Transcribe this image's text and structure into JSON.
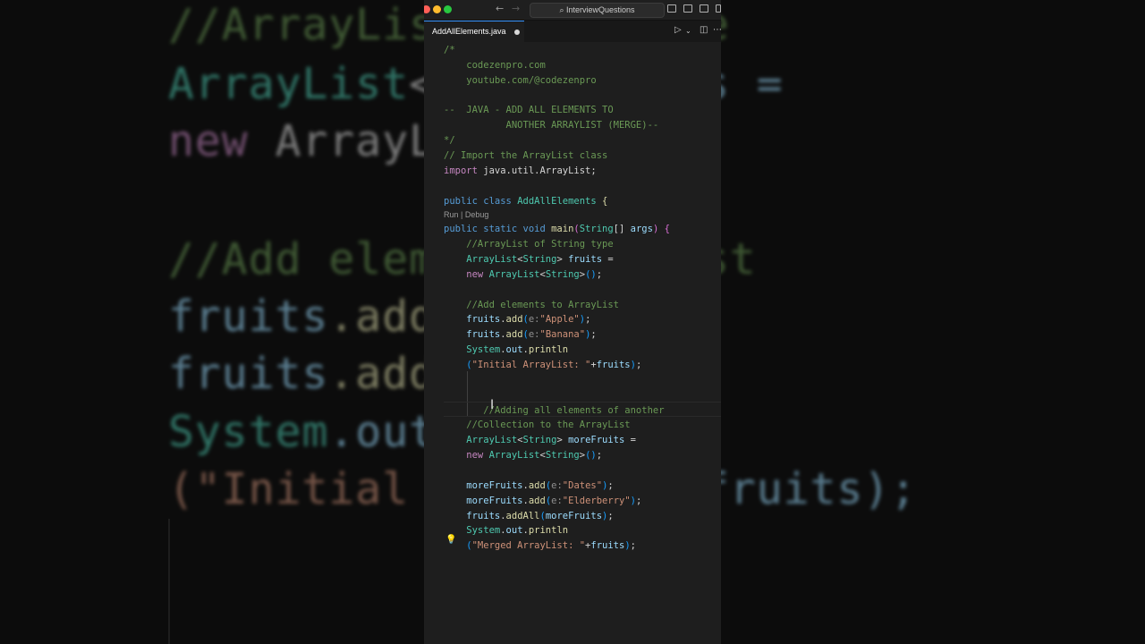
{
  "background": {
    "lines": [
      {
        "parts": [
          {
            "t": "//ArrayList",
            "c": "c-comment"
          },
          {
            "t": "       ",
            "c": "c-txt"
          },
          {
            "t": "ype",
            "c": "c-comment"
          }
        ]
      },
      {
        "parts": [
          {
            "t": "ArrayList",
            "c": "c-type"
          },
          {
            "t": "<S",
            "c": "c-txt"
          },
          {
            "t": "         ",
            "c": "c-txt"
          },
          {
            "t": "s =",
            "c": "c-var"
          }
        ]
      },
      {
        "parts": [
          {
            "t": "new ",
            "c": "c-kw"
          },
          {
            "t": "ArrayLi",
            "c": "c-txt"
          }
        ]
      },
      {
        "parts": [
          {
            "t": "//Add eleme",
            "c": "c-comment"
          },
          {
            "t": "       ",
            "c": "c-txt"
          },
          {
            "t": "List",
            "c": "c-comment"
          }
        ]
      },
      {
        "parts": [
          {
            "t": "fruits",
            "c": "c-var"
          },
          {
            "t": ".add(",
            "c": "c-fn"
          }
        ]
      },
      {
        "parts": [
          {
            "t": "fruits",
            "c": "c-var"
          },
          {
            "t": ".add(",
            "c": "c-fn"
          }
        ]
      },
      {
        "parts": [
          {
            "t": "System",
            "c": "c-type"
          },
          {
            "t": ".out.",
            "c": "c-var"
          }
        ]
      },
      {
        "parts": [
          {
            "t": "(\"Initial A",
            "c": "c-str"
          },
          {
            "t": "         ",
            "c": "c-txt"
          },
          {
            "t": "fruits);",
            "c": "c-var"
          }
        ]
      }
    ]
  },
  "titlebar": {
    "search_label": "InterviewQuestions",
    "colors": {
      "close": "#ff5f57",
      "minimize": "#febc2e",
      "maximize": "#28c840"
    }
  },
  "tab": {
    "label": "AddAllElements.java",
    "modified": true
  },
  "codelens": "Run | Debug",
  "code": [
    {
      "parts": [
        {
          "t": "/*",
          "c": "c-comment"
        }
      ]
    },
    {
      "parts": [
        {
          "t": "    codezenpro.com",
          "c": "c-comment"
        }
      ]
    },
    {
      "parts": [
        {
          "t": "    youtube.com/@codezenpro",
          "c": "c-comment"
        }
      ]
    },
    {
      "parts": [
        {
          "t": "",
          "c": "c-comment"
        }
      ]
    },
    {
      "parts": [
        {
          "t": "--  JAVA - ADD ALL ELEMENTS TO",
          "c": "c-comment"
        }
      ]
    },
    {
      "parts": [
        {
          "t": "           ANOTHER ARRAYLIST (MERGE)--",
          "c": "c-comment"
        }
      ]
    },
    {
      "parts": [
        {
          "t": "*/",
          "c": "c-comment"
        }
      ]
    },
    {
      "parts": [
        {
          "t": "// Import the ArrayList class",
          "c": "c-comment"
        }
      ]
    },
    {
      "parts": [
        {
          "t": "import ",
          "c": "c-kw"
        },
        {
          "t": "java.util.ArrayList;",
          "c": "c-txt"
        }
      ]
    },
    {
      "parts": [
        {
          "t": "",
          "c": "c-txt"
        }
      ]
    },
    {
      "parts": [
        {
          "t": "public class ",
          "c": "c-kw2"
        },
        {
          "t": "AddAllElements ",
          "c": "c-type"
        },
        {
          "t": "{",
          "c": "c-fn"
        }
      ]
    },
    {
      "parts": [
        {
          "t": "public static void ",
          "c": "c-kw2"
        },
        {
          "t": "main",
          "c": "c-fn"
        },
        {
          "t": "(",
          "c": "c-paren"
        },
        {
          "t": "String",
          "c": "c-type"
        },
        {
          "t": "[] ",
          "c": "c-txt"
        },
        {
          "t": "args",
          "c": "c-var"
        },
        {
          "t": ") ",
          "c": "c-paren"
        },
        {
          "t": "{",
          "c": "c-paren"
        }
      ]
    },
    {
      "parts": [
        {
          "t": "    //ArrayList of String type",
          "c": "c-comment"
        }
      ]
    },
    {
      "parts": [
        {
          "t": "    ArrayList",
          "c": "c-type"
        },
        {
          "t": "<",
          "c": "c-txt"
        },
        {
          "t": "String",
          "c": "c-type"
        },
        {
          "t": "> ",
          "c": "c-txt"
        },
        {
          "t": "fruits",
          "c": "c-var"
        },
        {
          "t": " =",
          "c": "c-txt"
        }
      ]
    },
    {
      "parts": [
        {
          "t": "    new ",
          "c": "c-kw"
        },
        {
          "t": "ArrayList",
          "c": "c-type"
        },
        {
          "t": "<",
          "c": "c-txt"
        },
        {
          "t": "String",
          "c": "c-type"
        },
        {
          "t": ">",
          "c": "c-txt"
        },
        {
          "t": "()",
          "c": "c-paren2"
        },
        {
          "t": ";",
          "c": "c-txt"
        }
      ]
    },
    {
      "parts": [
        {
          "t": "",
          "c": "c-txt"
        }
      ]
    },
    {
      "parts": [
        {
          "t": "    //Add elements to ArrayList",
          "c": "c-comment"
        }
      ]
    },
    {
      "parts": [
        {
          "t": "    fruits",
          "c": "c-var"
        },
        {
          "t": ".",
          "c": "c-txt"
        },
        {
          "t": "add",
          "c": "c-fn"
        },
        {
          "t": "(",
          "c": "c-paren2"
        },
        {
          "t": "e:",
          "c": "c-hint"
        },
        {
          "t": "\"Apple\"",
          "c": "c-str"
        },
        {
          "t": ")",
          "c": "c-paren2"
        },
        {
          "t": ";",
          "c": "c-txt"
        }
      ]
    },
    {
      "parts": [
        {
          "t": "    fruits",
          "c": "c-var"
        },
        {
          "t": ".",
          "c": "c-txt"
        },
        {
          "t": "add",
          "c": "c-fn"
        },
        {
          "t": "(",
          "c": "c-paren2"
        },
        {
          "t": "e:",
          "c": "c-hint"
        },
        {
          "t": "\"Banana\"",
          "c": "c-str"
        },
        {
          "t": ")",
          "c": "c-paren2"
        },
        {
          "t": ";",
          "c": "c-txt"
        }
      ]
    },
    {
      "parts": [
        {
          "t": "    System",
          "c": "c-type"
        },
        {
          "t": ".",
          "c": "c-txt"
        },
        {
          "t": "out",
          "c": "c-var"
        },
        {
          "t": ".",
          "c": "c-txt"
        },
        {
          "t": "println",
          "c": "c-fn"
        }
      ]
    },
    {
      "parts": [
        {
          "t": "    (",
          "c": "c-paren2"
        },
        {
          "t": "\"Initial ArrayList: \"",
          "c": "c-str"
        },
        {
          "t": "+",
          "c": "c-txt"
        },
        {
          "t": "fruits",
          "c": "c-var"
        },
        {
          "t": ")",
          "c": "c-paren2"
        },
        {
          "t": ";",
          "c": "c-txt"
        }
      ]
    },
    {
      "parts": [
        {
          "t": "",
          "c": "c-txt"
        }
      ]
    },
    {
      "parts": [
        {
          "t": "",
          "c": "c-txt"
        }
      ]
    },
    {
      "parts": [
        {
          "t": "       //Adding all elements of another",
          "c": "c-comment"
        }
      ]
    },
    {
      "parts": [
        {
          "t": "    //Collection to the ArrayList",
          "c": "c-comment"
        }
      ]
    },
    {
      "parts": [
        {
          "t": "    ArrayList",
          "c": "c-type"
        },
        {
          "t": "<",
          "c": "c-txt"
        },
        {
          "t": "String",
          "c": "c-type"
        },
        {
          "t": "> ",
          "c": "c-txt"
        },
        {
          "t": "moreFruits",
          "c": "c-var"
        },
        {
          "t": " =",
          "c": "c-txt"
        }
      ]
    },
    {
      "parts": [
        {
          "t": "    new ",
          "c": "c-kw"
        },
        {
          "t": "ArrayList",
          "c": "c-type"
        },
        {
          "t": "<",
          "c": "c-txt"
        },
        {
          "t": "String",
          "c": "c-type"
        },
        {
          "t": ">",
          "c": "c-txt"
        },
        {
          "t": "()",
          "c": "c-paren2"
        },
        {
          "t": ";",
          "c": "c-txt"
        }
      ]
    },
    {
      "parts": [
        {
          "t": "",
          "c": "c-txt"
        }
      ]
    },
    {
      "parts": [
        {
          "t": "    moreFruits",
          "c": "c-var"
        },
        {
          "t": ".",
          "c": "c-txt"
        },
        {
          "t": "add",
          "c": "c-fn"
        },
        {
          "t": "(",
          "c": "c-paren2"
        },
        {
          "t": "e:",
          "c": "c-hint"
        },
        {
          "t": "\"Dates\"",
          "c": "c-str"
        },
        {
          "t": ")",
          "c": "c-paren2"
        },
        {
          "t": ";",
          "c": "c-txt"
        }
      ]
    },
    {
      "parts": [
        {
          "t": "    moreFruits",
          "c": "c-var"
        },
        {
          "t": ".",
          "c": "c-txt"
        },
        {
          "t": "add",
          "c": "c-fn"
        },
        {
          "t": "(",
          "c": "c-paren2"
        },
        {
          "t": "e:",
          "c": "c-hint"
        },
        {
          "t": "\"Elderberry\"",
          "c": "c-str"
        },
        {
          "t": ")",
          "c": "c-paren2"
        },
        {
          "t": ";",
          "c": "c-txt"
        }
      ]
    },
    {
      "parts": [
        {
          "t": "    fruits",
          "c": "c-var"
        },
        {
          "t": ".",
          "c": "c-txt"
        },
        {
          "t": "addAll",
          "c": "c-fn"
        },
        {
          "t": "(",
          "c": "c-paren2"
        },
        {
          "t": "moreFruits",
          "c": "c-var"
        },
        {
          "t": ")",
          "c": "c-paren2"
        },
        {
          "t": ";",
          "c": "c-txt"
        }
      ]
    },
    {
      "parts": [
        {
          "t": "    System",
          "c": "c-type"
        },
        {
          "t": ".",
          "c": "c-txt"
        },
        {
          "t": "out",
          "c": "c-var"
        },
        {
          "t": ".",
          "c": "c-txt"
        },
        {
          "t": "println",
          "c": "c-fn"
        }
      ]
    },
    {
      "parts": [
        {
          "t": "    (",
          "c": "c-paren2"
        },
        {
          "t": "\"Merged ArrayList: \"",
          "c": "c-str"
        },
        {
          "t": "+",
          "c": "c-txt"
        },
        {
          "t": "fruits",
          "c": "c-var"
        },
        {
          "t": ")",
          "c": "c-paren2"
        },
        {
          "t": ";",
          "c": "c-txt"
        }
      ]
    }
  ]
}
